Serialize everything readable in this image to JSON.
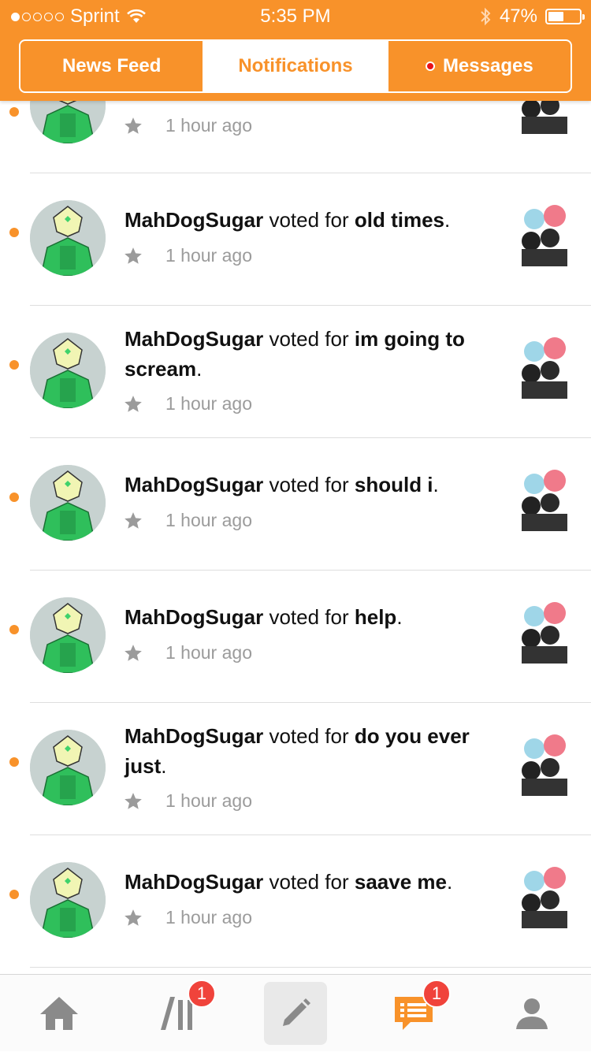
{
  "status_bar": {
    "carrier": "Sprint",
    "time": "5:35 PM",
    "battery": "47%",
    "signal_bars_full": 1,
    "signal_bars_total": 5
  },
  "segments": [
    {
      "label": "News Feed",
      "active": false
    },
    {
      "label": "Notifications",
      "active": true
    },
    {
      "label": "Messages",
      "active": false,
      "has_alert": true
    }
  ],
  "notifications": [
    {
      "user": "",
      "action": "",
      "target": "",
      "time": "1 hour ago",
      "unread": true
    },
    {
      "user": "MahDogSugar",
      "action": " voted for ",
      "target": "old times",
      "time": "1 hour ago",
      "unread": true
    },
    {
      "user": "MahDogSugar",
      "action": " voted for ",
      "target": "im going to scream",
      "time": "1 hour ago",
      "unread": true
    },
    {
      "user": "MahDogSugar",
      "action": " voted for ",
      "target": "should i",
      "time": "1 hour ago",
      "unread": true
    },
    {
      "user": "MahDogSugar",
      "action": " voted for ",
      "target": "help",
      "time": "1 hour ago",
      "unread": true
    },
    {
      "user": "MahDogSugar",
      "action": " voted for ",
      "target": "do you ever just",
      "time": "1 hour ago",
      "unread": true
    },
    {
      "user": "MahDogSugar",
      "action": " voted for ",
      "target": "saave me",
      "time": "1 hour ago",
      "unread": true
    }
  ],
  "tabbar": {
    "home_icon": "home-icon",
    "library_icon": "library-icon",
    "library_badge": "1",
    "compose_icon": "pencil-icon",
    "notifications_icon": "chat-list-icon",
    "notifications_badge": "1",
    "profile_icon": "user-icon"
  },
  "colors": {
    "brand": "#f8922a",
    "badge": "#f0433b",
    "alert": "#e8121a"
  }
}
